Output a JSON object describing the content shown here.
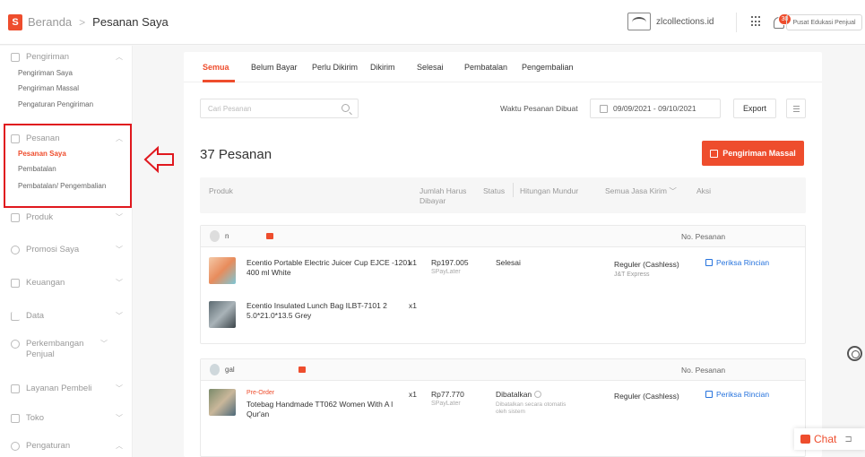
{
  "breadcrumb": {
    "home": "Beranda",
    "separator": ">",
    "current": "Pesanan Saya"
  },
  "header": {
    "logo_letter": "S",
    "shop_name": "zlcollections.id",
    "notification_count": "30",
    "education_label": "Pusat Edukasi Penjual"
  },
  "sidebar": [
    {
      "title": "Pengiriman",
      "icon": "truck-icon",
      "expanded": true,
      "items": [
        "Pengiriman Saya",
        "Pengiriman Massal",
        "Pengaturan Pengiriman"
      ]
    },
    {
      "title": "Pesanan",
      "icon": "clipboard-icon",
      "expanded": true,
      "items": [
        "Pesanan Saya",
        "Pembatalan",
        "Pembatalan/ Pengembalian"
      ],
      "active_item": "Pesanan Saya"
    },
    {
      "title": "Produk",
      "icon": "box-icon",
      "expanded": false,
      "items": []
    },
    {
      "title": "Promosi Saya",
      "icon": "tag-icon",
      "expanded": false,
      "items": []
    },
    {
      "title": "Keuangan",
      "icon": "wallet-icon",
      "expanded": false,
      "items": []
    },
    {
      "title": "Data",
      "icon": "chart-icon",
      "expanded": false,
      "items": []
    },
    {
      "title": "Perkembangan Penjual",
      "icon": "growth-icon",
      "expanded": false,
      "items": []
    },
    {
      "title": "Layanan Pembeli",
      "icon": "chat-bubble-icon",
      "expanded": false,
      "items": []
    },
    {
      "title": "Toko",
      "icon": "store-icon",
      "expanded": false,
      "items": []
    },
    {
      "title": "Pengaturan",
      "icon": "gear-icon",
      "expanded": true,
      "items": []
    }
  ],
  "tabs": [
    "Semua",
    "Belum Bayar",
    "Perlu Dikirim",
    "Dikirim",
    "Selesai",
    "Pembatalan",
    "Pengembalian"
  ],
  "active_tab": "Semua",
  "filters": {
    "search_placeholder": "Cari Pesanan",
    "date_label": "Waktu Pesanan Dibuat",
    "date_range": "09/09/2021 - 09/10/2021",
    "export_label": "Export"
  },
  "order_count": "37 Pesanan",
  "mass_shipping_label": "Pengiriman Massal",
  "table_headers": {
    "product": "Produk",
    "total": "Jumlah Harus Dibayar",
    "status": "Status",
    "countdown": "Hitungan Mundur",
    "courier_filter": "Semua Jasa Kirim",
    "action": "Aksi"
  },
  "orders": [
    {
      "buyer": "n",
      "order_no_label": "No. Pesanan",
      "products": [
        {
          "name": "Ecentio Portable Electric Juicer Cup EJCE -1201 400 ml White",
          "qty": "x1"
        },
        {
          "name": "Ecentio Insulated Lunch Bag ILBT-7101 2 5.0*21.0*13.5 Grey",
          "qty": "x1"
        }
      ],
      "price": "Rp197.005",
      "payment": "SPayLater",
      "status": "Selesai",
      "status_note": "",
      "shipping": "Reguler (Cashless)",
      "courier": "J&T Express",
      "action": "Periksa Rincian"
    },
    {
      "buyer": "gal",
      "order_no_label": "No. Pesanan",
      "products": [
        {
          "tag": "Pre-Order",
          "name": "Totebag Handmade TT062 Women With A l Qur'an",
          "qty": "x1"
        }
      ],
      "price": "Rp77.770",
      "payment": "SPayLater",
      "status": "Dibatalkan",
      "status_note": "Dibatalkan secara otomatis oleh sistem",
      "shipping": "Reguler (Cashless)",
      "courier": "",
      "action": "Periksa Rincian"
    }
  ],
  "chat_widget": {
    "label": "Chat"
  },
  "colors": {
    "accent": "#ee4d2d",
    "link": "#2673dd",
    "highlight": "#e0181e"
  }
}
